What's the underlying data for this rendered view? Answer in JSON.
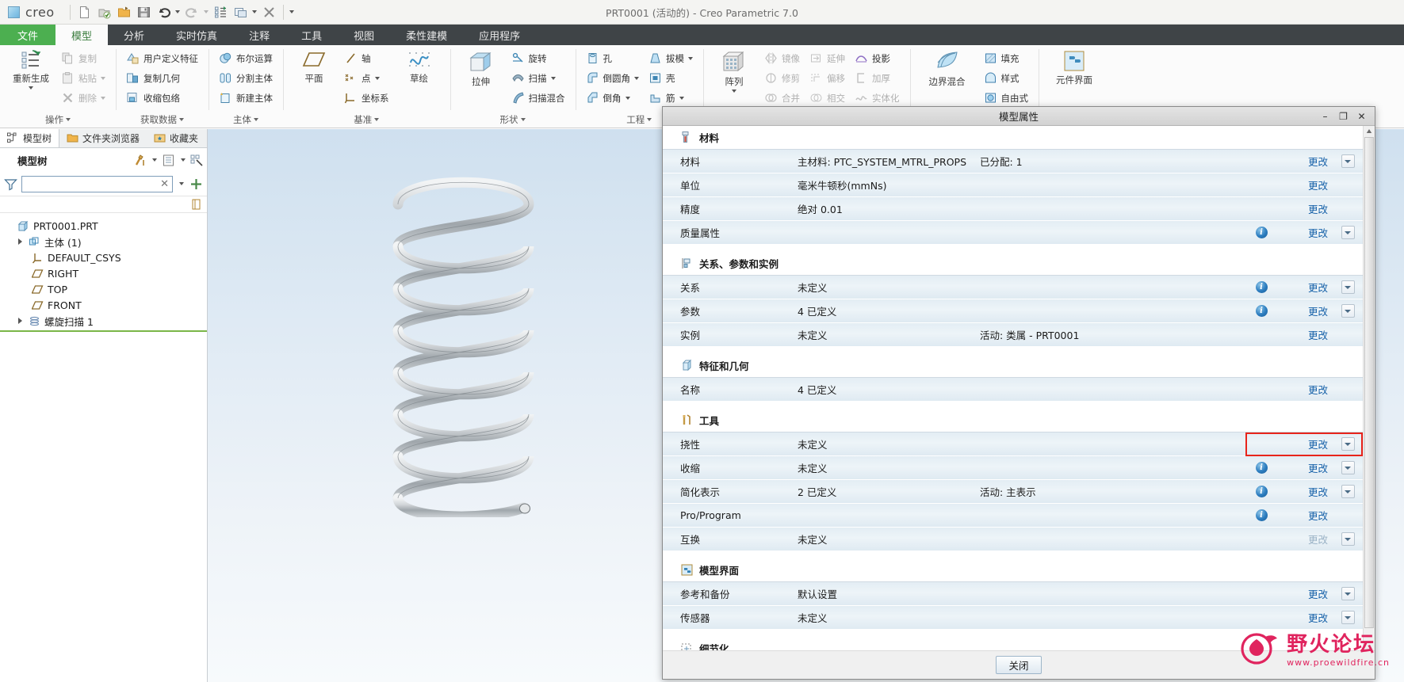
{
  "window": {
    "title": "PRT0001 (活动的) - Creo Parametric 7.0",
    "brand": "creo"
  },
  "qat": {
    "items": [
      {
        "name": "new-file-icon",
        "label": "新建"
      },
      {
        "name": "open-checked-icon",
        "label": "打开会话"
      },
      {
        "name": "open-folder-icon",
        "label": "打开"
      },
      {
        "name": "save-icon",
        "label": "保存"
      },
      {
        "name": "undo-icon",
        "label": "撤销"
      },
      {
        "name": "redo-icon",
        "label": "重做"
      },
      {
        "name": "regenerate-icon",
        "label": "重新生成"
      },
      {
        "name": "window-icon",
        "label": "窗口"
      },
      {
        "name": "close-window-icon",
        "label": "关闭"
      }
    ]
  },
  "tabs": [
    {
      "label": "文件",
      "kind": "file"
    },
    {
      "label": "模型",
      "kind": "active"
    },
    {
      "label": "分析",
      "kind": "normal"
    },
    {
      "label": "实时仿真",
      "kind": "normal"
    },
    {
      "label": "注释",
      "kind": "normal"
    },
    {
      "label": "工具",
      "kind": "normal"
    },
    {
      "label": "视图",
      "kind": "normal"
    },
    {
      "label": "柔性建模",
      "kind": "normal"
    },
    {
      "label": "应用程序",
      "kind": "normal"
    }
  ],
  "ribbon": {
    "groups": [
      {
        "label": "操作",
        "big": [
          {
            "label": "重新生成",
            "icon": "regenerate-icon",
            "dropdown": true
          }
        ],
        "cols": [
          [
            {
              "label": "复制",
              "icon": "copy-icon",
              "disabled": true
            },
            {
              "label": "粘贴",
              "icon": "paste-icon",
              "disabled": true,
              "dropdown": true
            },
            {
              "label": "删除",
              "icon": "delete-icon",
              "disabled": true,
              "dropdown": true
            }
          ]
        ]
      },
      {
        "label": "获取数据",
        "big": [],
        "cols": [
          [
            {
              "label": "用户定义特征",
              "icon": "udf-icon"
            },
            {
              "label": "复制几何",
              "icon": "copy-geom-icon"
            },
            {
              "label": "收缩包络",
              "icon": "shrinkwrap-icon"
            }
          ]
        ]
      },
      {
        "label": "主体",
        "big": [],
        "cols": [
          [
            {
              "label": "布尔运算",
              "icon": "boolean-icon"
            },
            {
              "label": "分割主体",
              "icon": "split-body-icon"
            },
            {
              "label": "新建主体",
              "icon": "new-body-icon"
            }
          ]
        ]
      },
      {
        "label": "基准",
        "big": [
          {
            "label": "平面",
            "icon": "plane-icon"
          }
        ],
        "cols": [
          [
            {
              "label": "轴",
              "icon": "axis-icon"
            },
            {
              "label": "点",
              "icon": "point-icon",
              "dropdown": true
            },
            {
              "label": "坐标系",
              "icon": "csys-icon"
            }
          ]
        ],
        "big2": [
          {
            "label": "草绘",
            "icon": "sketch-icon"
          }
        ]
      },
      {
        "label": "形状",
        "big": [
          {
            "label": "拉伸",
            "icon": "extrude-icon"
          }
        ],
        "cols": [
          [
            {
              "label": "旋转",
              "icon": "revolve-icon"
            },
            {
              "label": "扫描",
              "icon": "sweep-icon",
              "dropdown": true
            },
            {
              "label": "扫描混合",
              "icon": "swept-blend-icon"
            }
          ]
        ]
      },
      {
        "label": "工程",
        "big": [],
        "cols": [
          [
            {
              "label": "孔",
              "icon": "hole-icon"
            },
            {
              "label": "倒圆角",
              "icon": "round-icon",
              "dropdown": true
            },
            {
              "label": "倒角",
              "icon": "chamfer-icon",
              "dropdown": true
            }
          ],
          [
            {
              "label": "拔模",
              "icon": "draft-icon",
              "dropdown": true
            },
            {
              "label": "壳",
              "icon": "shell-icon"
            },
            {
              "label": "筋",
              "icon": "rib-icon",
              "dropdown": true
            }
          ]
        ]
      },
      {
        "label": "",
        "big": [
          {
            "label": "阵列",
            "icon": "pattern-icon",
            "dropdown": true
          }
        ],
        "cols": [
          [
            {
              "label": "镜像",
              "icon": "mirror-icon",
              "disabled": true
            },
            {
              "label": "修剪",
              "icon": "trim-icon",
              "disabled": true
            },
            {
              "label": "合并",
              "icon": "merge-icon",
              "disabled": true
            }
          ],
          [
            {
              "label": "延伸",
              "icon": "extend-icon",
              "disabled": true
            },
            {
              "label": "偏移",
              "icon": "offset-icon",
              "disabled": true
            },
            {
              "label": "相交",
              "icon": "intersect-icon",
              "disabled": true
            }
          ],
          [
            {
              "label": "投影",
              "icon": "project-icon"
            },
            {
              "label": "加厚",
              "icon": "thicken-icon",
              "disabled": true
            },
            {
              "label": "实体化",
              "icon": "solidify-icon",
              "disabled": true
            }
          ]
        ]
      },
      {
        "label": "",
        "big": [
          {
            "label": "边界混合",
            "icon": "boundary-blend-icon"
          }
        ],
        "cols": [
          [
            {
              "label": "填充",
              "icon": "fill-icon"
            },
            {
              "label": "样式",
              "icon": "style-icon"
            },
            {
              "label": "自由式",
              "icon": "freestyle-icon"
            }
          ]
        ]
      },
      {
        "label": "",
        "big": [
          {
            "label": "元件界面",
            "icon": "component-interface-icon"
          }
        ],
        "cols": []
      }
    ]
  },
  "leftpanel": {
    "tabs": [
      {
        "label": "模型树",
        "icon": "model-tree-icon",
        "active": true
      },
      {
        "label": "文件夹浏览器",
        "icon": "folder-browser-icon",
        "active": false
      },
      {
        "label": "收藏夹",
        "icon": "favorites-icon",
        "active": false
      }
    ],
    "header": "模型树",
    "filter": {
      "value": "",
      "placeholder": ""
    },
    "tree": [
      {
        "label": "PRT0001.PRT",
        "icon": "part-icon",
        "indent": 0,
        "twisty": false
      },
      {
        "label": "主体 (1)",
        "icon": "bodies-icon",
        "indent": 1,
        "twisty": true
      },
      {
        "label": "DEFAULT_CSYS",
        "icon": "csys-icon",
        "indent": 2,
        "twisty": false
      },
      {
        "label": "RIGHT",
        "icon": "plane-icon",
        "indent": 2,
        "twisty": false
      },
      {
        "label": "TOP",
        "icon": "plane-icon",
        "indent": 2,
        "twisty": false
      },
      {
        "label": "FRONT",
        "icon": "plane-icon",
        "indent": 2,
        "twisty": false
      },
      {
        "label": "螺旋扫描 1",
        "icon": "helical-sweep-icon",
        "indent": 1,
        "twisty": true
      }
    ]
  },
  "dialog": {
    "title": "模型属性",
    "window_buttons": [
      {
        "name": "minimize-button",
        "glyph": "–"
      },
      {
        "name": "maximize-button",
        "glyph": "❐"
      },
      {
        "name": "close-button",
        "glyph": "✕"
      }
    ],
    "change_label": "更改",
    "close_label": "关闭",
    "sections": [
      {
        "title": "材料",
        "icon": "material-icon",
        "rows": [
          {
            "label": "材料",
            "value": "主材料: PTC_SYSTEM_MTRL_PROPS",
            "extra": "已分配: 1",
            "info": false,
            "change": "更改",
            "change_disabled": false,
            "chevron": true
          },
          {
            "label": "单位",
            "value": "毫米牛顿秒(mmNs)",
            "extra": "",
            "info": false,
            "change": "更改",
            "change_disabled": false,
            "chevron": false
          },
          {
            "label": "精度",
            "value": "绝对 0.01",
            "extra": "",
            "info": false,
            "change": "更改",
            "change_disabled": false,
            "chevron": false
          },
          {
            "label": "质量属性",
            "value": "",
            "extra": "",
            "info": true,
            "change": "更改",
            "change_disabled": false,
            "chevron": true
          }
        ]
      },
      {
        "title": "关系、参数和实例",
        "icon": "relations-icon",
        "rows": [
          {
            "label": "关系",
            "value": "未定义",
            "extra": "",
            "info": true,
            "change": "更改",
            "change_disabled": false,
            "chevron": true
          },
          {
            "label": "参数",
            "value": "4 已定义",
            "extra": "",
            "info": true,
            "change": "更改",
            "change_disabled": false,
            "chevron": true
          },
          {
            "label": "实例",
            "value": "未定义",
            "extra": "活动: 类属 - PRT0001",
            "info": false,
            "change": "更改",
            "change_disabled": false,
            "chevron": false
          }
        ]
      },
      {
        "title": "特征和几何",
        "icon": "features-icon",
        "rows": [
          {
            "label": "名称",
            "value": "4 已定义",
            "extra": "",
            "info": false,
            "change": "更改",
            "change_disabled": false,
            "chevron": false
          }
        ]
      },
      {
        "title": "工具",
        "icon": "tools-icon",
        "rows": [
          {
            "label": "挠性",
            "value": "未定义",
            "extra": "",
            "info": false,
            "change": "更改",
            "change_disabled": false,
            "chevron": true,
            "highlighted": true
          },
          {
            "label": "收缩",
            "value": "未定义",
            "extra": "",
            "info": true,
            "change": "更改",
            "change_disabled": false,
            "chevron": true
          },
          {
            "label": "简化表示",
            "value": "2 已定义",
            "extra": "活动: 主表示",
            "info": true,
            "change": "更改",
            "change_disabled": false,
            "chevron": true
          },
          {
            "label": "Pro/Program",
            "value": "",
            "extra": "",
            "info": true,
            "change": "更改",
            "change_disabled": false,
            "chevron": false
          },
          {
            "label": "互换",
            "value": "未定义",
            "extra": "",
            "info": false,
            "change": "更改",
            "change_disabled": true,
            "chevron": true
          }
        ]
      },
      {
        "title": "模型界面",
        "icon": "model-interface-icon",
        "rows": [
          {
            "label": "参考和备份",
            "value": "默认设置",
            "extra": "",
            "info": false,
            "change": "更改",
            "change_disabled": false,
            "chevron": true
          },
          {
            "label": "传感器",
            "value": "未定义",
            "extra": "",
            "info": false,
            "change": "更改",
            "change_disabled": false,
            "chevron": true
          }
        ]
      },
      {
        "title": "细节化",
        "icon": "detail-icon",
        "rows": []
      }
    ]
  },
  "watermark": {
    "line1": "野火论坛",
    "line2": "www.proewildfire.cn"
  },
  "colors": {
    "accent_green": "#4caf50",
    "ribbon_dark": "#3f4447",
    "link_blue": "#1560a8",
    "highlight_red": "#e8241b",
    "watermark_pink": "#e0245e"
  }
}
